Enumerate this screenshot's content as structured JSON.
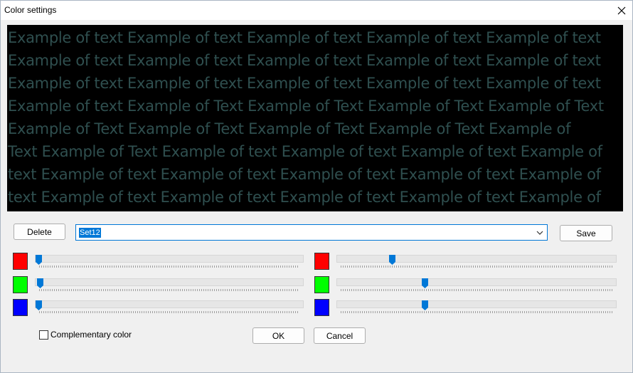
{
  "window": {
    "title": "Color settings",
    "close_glyph": "✕"
  },
  "preview": {
    "lines": [
      "Example of text Example of text Example of text Example of text Example of text",
      "Example of text Example of text Example of text Example of text Example of text",
      "Example of text Example of text Example of text Example of text Example of text",
      "Example of text Example of Text Example of Text Example of Text Example of Text",
      "Example of Text Example of Text Example of Text Example of Text Example of",
      "Text Example of Text Example of text Example of text Example of text Example of",
      "text Example of text Example of text Example of text Example of text Example of",
      "text Example of text Example of text Example of text Example of text Example of"
    ],
    "background_color": "#000000",
    "text_color": "#2f4f4f"
  },
  "toolbar": {
    "delete_label": "Delete",
    "preset_value": "Set12",
    "save_label": "Save"
  },
  "colors": {
    "red": "#ff0000",
    "green": "#00ff00",
    "blue": "#0000ff",
    "accent": "#0078d7"
  },
  "sliders": {
    "left": {
      "red": 0,
      "green": 0.005,
      "blue": 0
    },
    "right": {
      "red": 0.19,
      "green": 0.31,
      "blue": 0.31
    }
  },
  "options": {
    "complementary_label": "Complementary color",
    "complementary_checked": false
  },
  "footer": {
    "ok_label": "OK",
    "cancel_label": "Cancel"
  }
}
